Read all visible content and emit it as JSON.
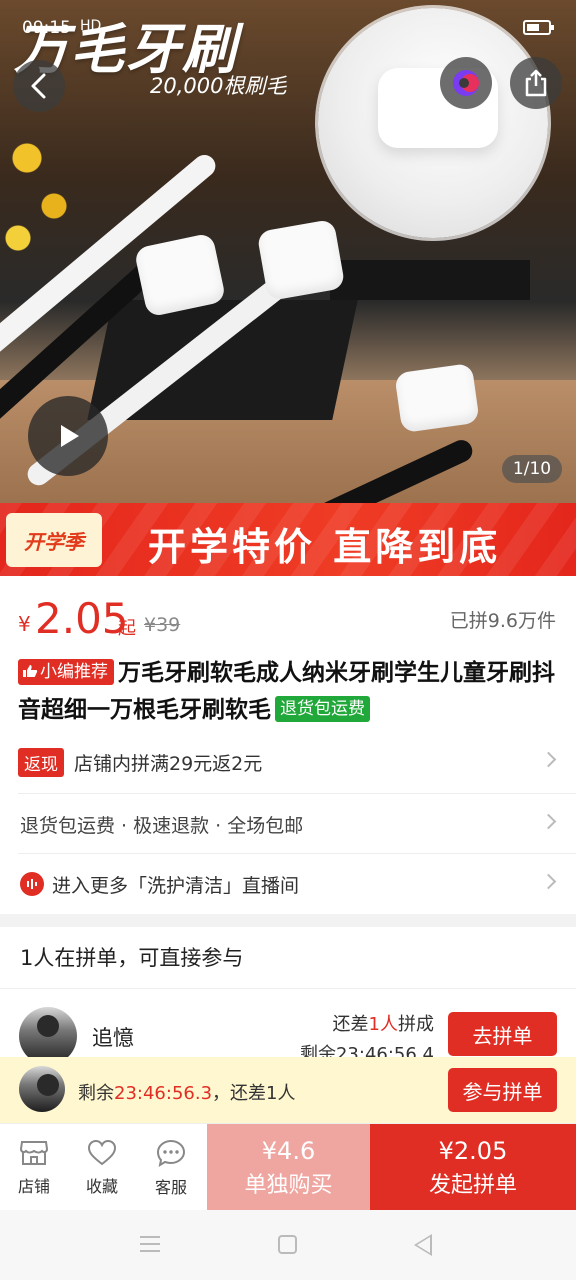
{
  "status_bar": {
    "time": "09:15",
    "network": "HD"
  },
  "hero": {
    "title": "万毛牙刷",
    "subtitle": "20,000根刷毛",
    "counter": "1/10"
  },
  "banner": {
    "badge": "开学季",
    "text": "开学特价  直降到底"
  },
  "price": {
    "currency": "¥",
    "value": "2.05",
    "suffix": "起",
    "original": "¥39",
    "sold": "已拼9.6万件"
  },
  "product": {
    "tag_recommend": "小编推荐",
    "title": "万毛牙刷软毛成人纳米牙刷学生儿童牙刷抖音超细一万根毛牙刷软毛",
    "tag_return": "退货包运费"
  },
  "cashback": {
    "tag": "返现",
    "text": "店铺内拼满29元返2元"
  },
  "services": {
    "text": "退货包运费 · 极速退款 · 全场包邮"
  },
  "live": {
    "text": "进入更多「洗护清洁」直播间"
  },
  "group": {
    "heading": "1人在拼单，可直接参与",
    "item": {
      "name": "追憶",
      "need_prefix": "还差",
      "need_count": "1人",
      "need_suffix": "拼成",
      "remaining": "剩余23:46:56.4",
      "button": "去拼单"
    }
  },
  "notice": {
    "prefix": "剩余",
    "time": "23:46:56.3",
    "suffix": "，还差1人",
    "button": "参与拼单"
  },
  "bottom_bar": {
    "store": "店铺",
    "favorite": "收藏",
    "service": "客服",
    "buy_alone_price": "¥4.6",
    "buy_alone_label": "单独购买",
    "buy_group_price": "¥2.05",
    "buy_group_label": "发起拼单"
  },
  "colors": {
    "accent": "#e02e24",
    "light_accent": "#f0a6a0",
    "green_tag": "#21a83a",
    "notice_bg": "#fff7d0"
  },
  "icons": [
    "back-arrow-icon",
    "pdd-logo-icon",
    "share-icon",
    "play-icon",
    "thumbs-up-icon",
    "chevron-right-icon",
    "live-icon",
    "store-icon",
    "heart-icon",
    "chat-icon"
  ]
}
